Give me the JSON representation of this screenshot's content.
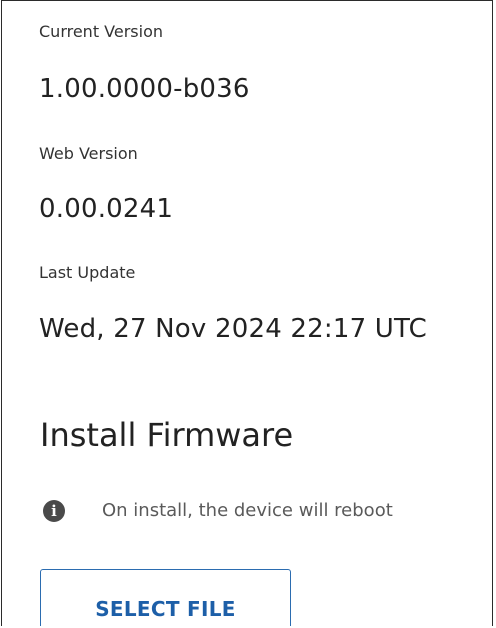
{
  "firmware_info": {
    "current_version_label": "Current Version",
    "current_version_value": "1.00.0000-b036",
    "web_version_label": "Web Version",
    "web_version_value": "0.00.0241",
    "last_update_label": "Last Update",
    "last_update_value": "Wed, 27 Nov 2024 22:17 UTC"
  },
  "install": {
    "title": "Install Firmware",
    "notice_icon": "info-icon",
    "notice_text": "On install, the device will reboot",
    "select_file_label": "SELECT FILE"
  },
  "colors": {
    "accent": "#1d5fa8",
    "icon": "#4a4a4a"
  }
}
